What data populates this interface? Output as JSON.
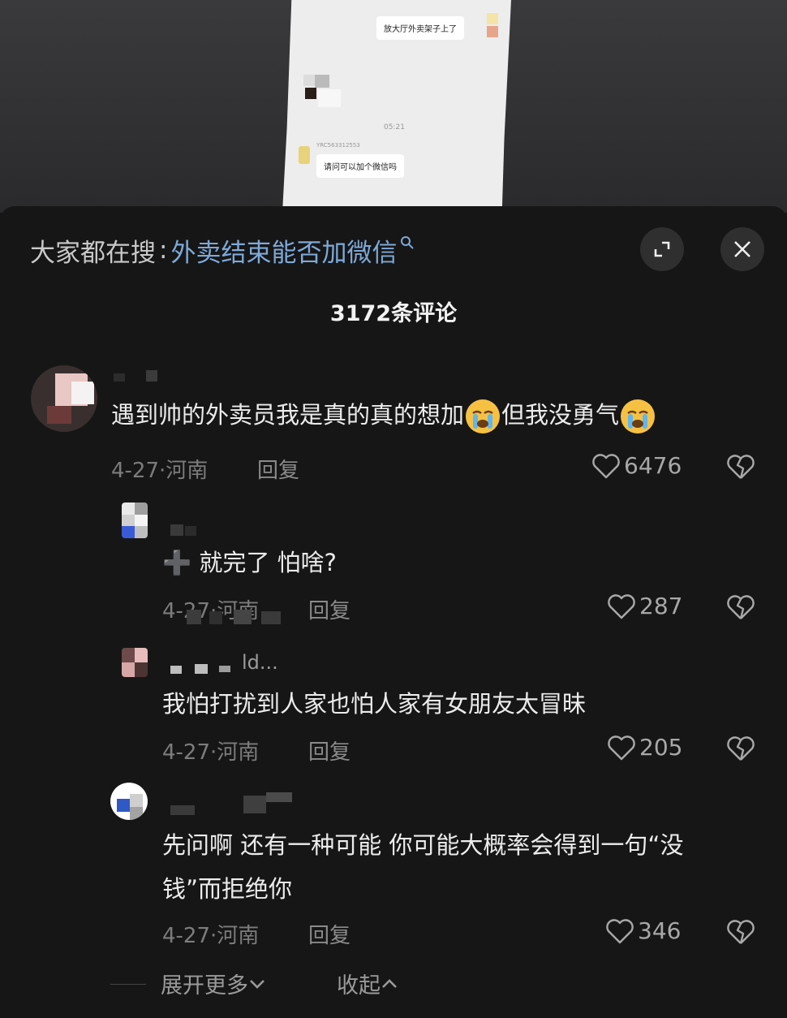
{
  "video": {
    "bubble_sent": "放大厅外卖架子上了",
    "chat_time": "05:21",
    "chat_user_id": "YRC563312553",
    "bubble_received": "请问可以加个微信吗"
  },
  "header": {
    "search_prefix": "大家都在搜",
    "search_sep": ":",
    "search_term": "外卖结束能否加微信",
    "comment_count": "3172条评论"
  },
  "comments": [
    {
      "text_before": "遇到帅的外卖员我是真的真的想加",
      "text_middle": "但我没勇气",
      "date_loc": "4-27·河南",
      "reply": "回复",
      "likes": "6476"
    },
    {
      "text": "就完了 怕啥?",
      "prefix_glyph": "➕",
      "date_loc": "4-27·河南",
      "reply": "回复",
      "likes": "287",
      "username_partial": "..."
    },
    {
      "text": "我怕打扰到人家也怕人家有女朋友太冒昧",
      "date_loc": "4-27·河南",
      "reply": "回复",
      "likes": "205",
      "username_partial": "ld..."
    },
    {
      "text_line1": "先问啊 还有一种可能 你可能大概率会得到一句“没",
      "text_line2": "钱”而拒绝你",
      "date_loc": "4-27·河南",
      "reply": "回复",
      "likes": "346"
    }
  ],
  "footer": {
    "expand_more": "展开更多",
    "collapse": "收起"
  },
  "colors": {
    "background": "#161616",
    "search_term": "#7ea9d8",
    "emoji": "#f6c143"
  },
  "icons": [
    "search-icon",
    "expand-icon",
    "close-icon",
    "heart-icon",
    "broken-heart-icon",
    "crying-emoji",
    "chevron-down-icon",
    "chevron-up-icon"
  ]
}
